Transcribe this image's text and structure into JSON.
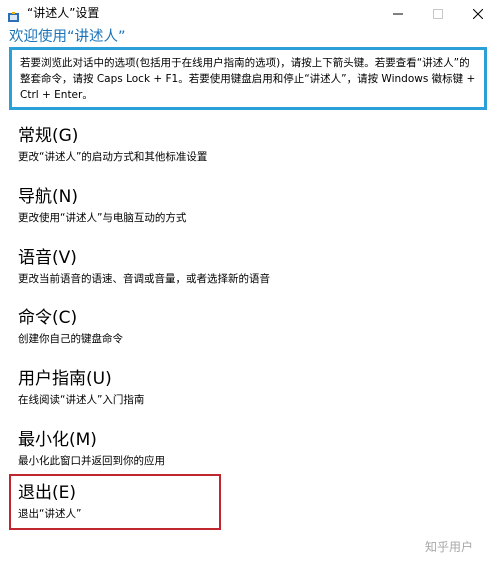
{
  "window": {
    "title": "“讲述人”设置"
  },
  "welcome": {
    "heading": "欢迎使用“讲述人”",
    "intro": "若要浏览此对话中的选项(包括用于在线用户指南的选项)，请按上下箭头键。若要查看“讲述人”的整套命令，请按 Caps Lock + F1。若要使用键盘启用和停止“讲述人”，请按 Windows 徽标键 + Ctrl + Enter。"
  },
  "menu": {
    "items": [
      {
        "title": "常规(G)",
        "desc": "更改“讲述人”的启动方式和其他标准设置"
      },
      {
        "title": "导航(N)",
        "desc": "更改使用“讲述人”与电脑互动的方式"
      },
      {
        "title": "语音(V)",
        "desc": "更改当前语音的语速、音调或音量，或者选择新的语音"
      },
      {
        "title": "命令(C)",
        "desc": "创建你自己的键盘命令"
      },
      {
        "title": "用户指南(U)",
        "desc": "在线阅读“讲述人”入门指南"
      },
      {
        "title": "最小化(M)",
        "desc": "最小化此窗口并返回到你的应用"
      },
      {
        "title": "退出(E)",
        "desc": "退出“讲述人”"
      }
    ]
  },
  "watermark": {
    "text": "知乎用户"
  },
  "colors": {
    "accent": "#1a73b8",
    "focus_border": "#2a9fd8",
    "selected_border": "#c0262d"
  }
}
